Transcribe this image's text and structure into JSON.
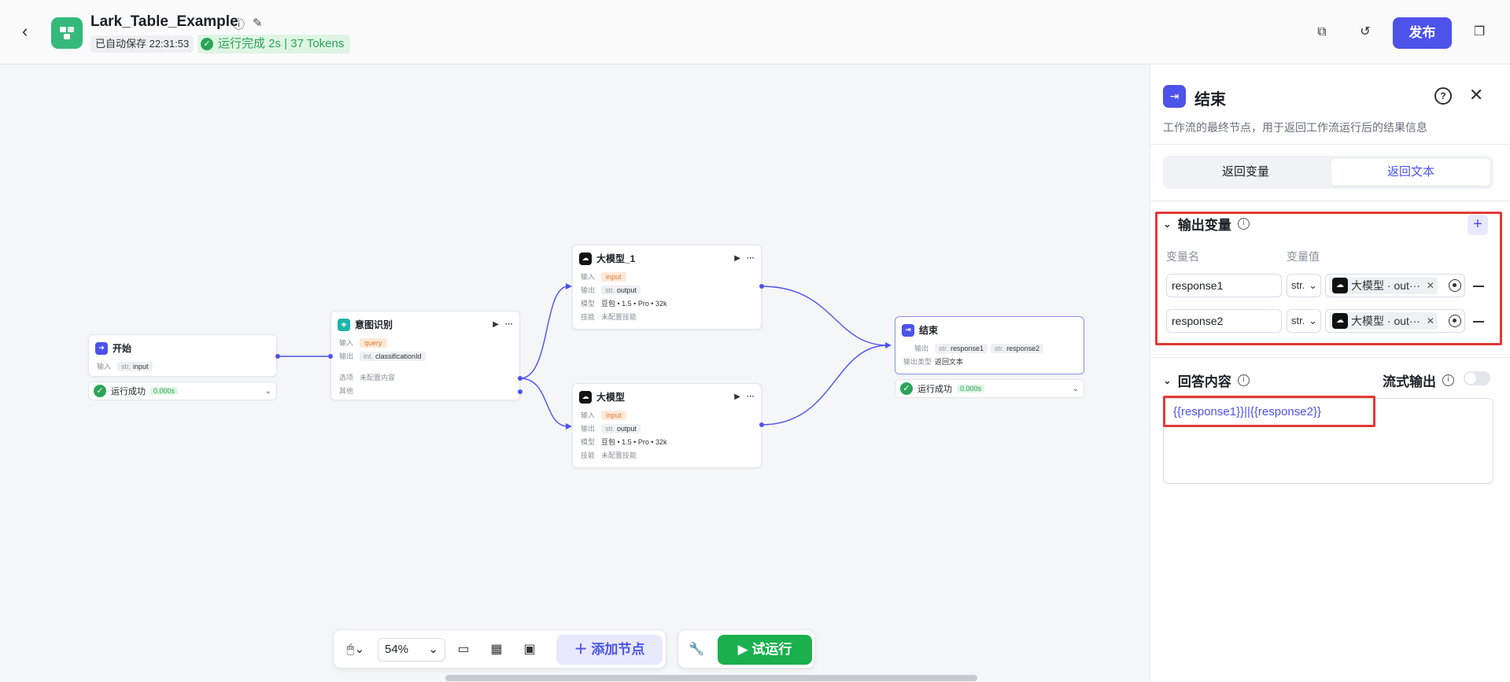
{
  "header": {
    "title": "Lark_Table_Example",
    "autosave": "已自动保存 22:31:53",
    "run_status": "运行完成 2s | 37 Tokens",
    "publish": "发布"
  },
  "nodes": {
    "start": {
      "title": "开始",
      "input_label": "输入",
      "input_type": "str.",
      "input_value": "input",
      "status": "运行成功",
      "time": "0.000s"
    },
    "intent": {
      "title": "意图识别",
      "input_label": "输入",
      "input_value": "query",
      "output_label": "输出",
      "output_type": "int.",
      "output_value": "classificationId",
      "option_label": "选项",
      "option_value": "未配置内容",
      "other_label": "其他"
    },
    "llm1": {
      "title": "大模型_1",
      "input_label": "输入",
      "input_value": "input",
      "output_label": "输出",
      "output_type": "str.",
      "output_value": "output",
      "model_label": "模型",
      "model_value": "豆包 • 1.5 • Pro • 32k",
      "skill_label": "技能",
      "skill_value": "未配置技能"
    },
    "llm": {
      "title": "大模型",
      "input_label": "输入",
      "input_value": "input",
      "output_label": "输出",
      "output_type": "str.",
      "output_value": "output",
      "model_label": "模型",
      "model_value": "豆包 • 1.5 • Pro • 32k",
      "skill_label": "技能",
      "skill_value": "未配置技能"
    },
    "end": {
      "title": "结束",
      "output_label": "输出",
      "output_type": "str.",
      "out1": "response1",
      "out2": "response2",
      "otype_label": "输出类型",
      "otype_value": "返回文本",
      "status": "运行成功",
      "time": "0.000s"
    }
  },
  "toolbar": {
    "zoom": "54%",
    "add_node": "添加节点",
    "try_run": "试运行"
  },
  "panel": {
    "title": "结束",
    "description": "工作流的最终节点，用于返回工作流运行后的结果信息",
    "tabs": [
      "返回变量",
      "返回文本"
    ],
    "output_section": "输出变量",
    "col_name": "变量名",
    "col_value": "变量值",
    "rows": [
      {
        "name": "response1",
        "type": "str.",
        "ref": "大模型 · out···"
      },
      {
        "name": "response2",
        "type": "str.",
        "ref": "大模型 · out···"
      }
    ],
    "answer_section": "回答内容",
    "stream_label": "流式输出",
    "answer_text": "{{response1}}||{{response2}}"
  },
  "colors": {
    "accent": "#4d53e8",
    "success": "#2aa457",
    "highlight": "#e53935"
  },
  "icons": [
    "back-icon",
    "info-icon",
    "edit-icon",
    "copy-icon",
    "history-icon",
    "duplicate-icon",
    "play-icon",
    "more-icon",
    "close-icon",
    "help-icon",
    "plus-icon",
    "minus-icon",
    "target-icon",
    "chevron-down-icon",
    "wrench-icon",
    "mouse-icon",
    "comment-icon",
    "grid-icon",
    "minimap-icon"
  ]
}
